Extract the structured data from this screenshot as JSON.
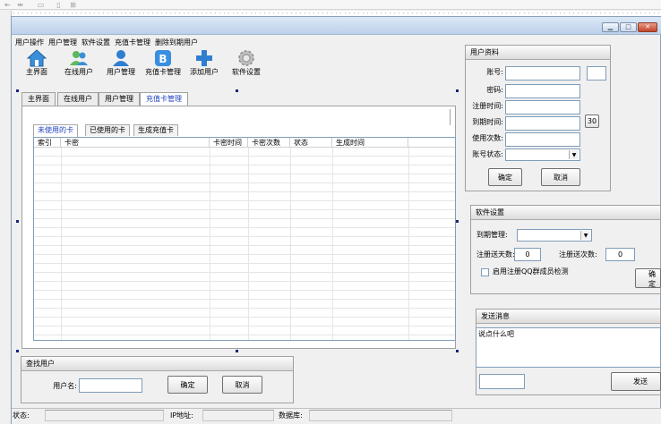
{
  "menu": [
    "用户操作",
    "用户管理",
    "软件设置",
    "充值卡管理",
    "删除到期用户"
  ],
  "toolbar": [
    {
      "label": "主界面",
      "icon": "home-icon"
    },
    {
      "label": "在线用户",
      "icon": "online-users-icon"
    },
    {
      "label": "用户管理",
      "icon": "user-icon"
    },
    {
      "label": "充值卡管理",
      "icon": "recharge-card-icon"
    },
    {
      "label": "添加用户",
      "icon": "add-icon"
    },
    {
      "label": "软件设置",
      "icon": "gear-icon"
    }
  ],
  "main_tabs": [
    "主界面",
    "在线用户",
    "用户管理",
    "充值卡管理"
  ],
  "card_tabs": [
    "未使用的卡",
    "已使用的卡",
    "生成充值卡"
  ],
  "card_table": {
    "columns": [
      "索引",
      "卡密",
      "卡密时间",
      "卡密次数",
      "状态",
      "生成时间"
    ],
    "rows": []
  },
  "user_info": {
    "title": "用户资料",
    "labels": {
      "account": "账号:",
      "password": "密码:",
      "register_time": "注册时间:",
      "expire_time": "到期时间:",
      "use_count": "使用次数:",
      "account_status": "账号状态:"
    },
    "values": {
      "account": "",
      "password": "",
      "register_time": "",
      "expire_time": "",
      "use_count": "",
      "account_status": "",
      "side_box": ""
    },
    "days_button": "30",
    "ok": "确定",
    "cancel": "取消"
  },
  "software_settings": {
    "title": "软件设置",
    "expire_mgmt_label": "到期管理:",
    "expire_mgmt_value": "",
    "gift_days_label": "注册送天数:",
    "gift_days_value": "0",
    "gift_count_label": "注册送次数:",
    "gift_count_value": "0",
    "qq_check_label": "启用注册QQ群成员检测",
    "confirm": "确定"
  },
  "send_message": {
    "title": "发送消息",
    "message": "说点什么吧",
    "target_value": "",
    "send": "发送"
  },
  "find_user": {
    "title": "查找用户",
    "username_label": "用户名:",
    "username_value": "",
    "ok": "确定",
    "cancel": "取消"
  },
  "status_bar": {
    "status_label": "状态:",
    "status_value": "",
    "ip_label": "IP地址:",
    "ip_value": "",
    "db_label": "数据库:",
    "db_value": ""
  },
  "colors": {
    "active_tab_text": "#1e3fc0",
    "title_bar": "#bcd1ea",
    "close_button": "#c2452a",
    "handle": "#1a237e"
  }
}
